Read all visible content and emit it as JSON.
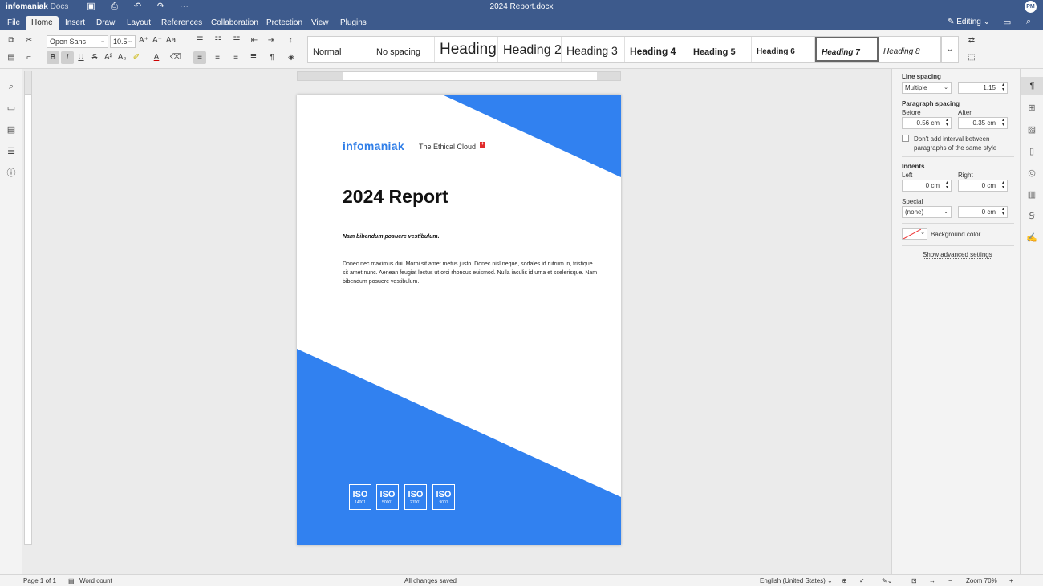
{
  "app": {
    "brand": "infomaniak",
    "brand_product": "Docs",
    "doc_title": "2024 Report.docx",
    "user_initials": "PM",
    "editing_label": "Editing"
  },
  "menu": {
    "file": "File",
    "home": "Home",
    "insert": "Insert",
    "draw": "Draw",
    "layout": "Layout",
    "references": "References",
    "collaboration": "Collaboration",
    "protection": "Protection",
    "view": "View",
    "plugins": "Plugins"
  },
  "toolbar": {
    "font_name": "Open Sans",
    "font_size": "10.5"
  },
  "styles": {
    "normal": "Normal",
    "no_spacing": "No spacing",
    "h1": "Heading",
    "h2": "Heading 2",
    "h3": "Heading 3",
    "h4": "Heading 4",
    "h5": "Heading 5",
    "h6": "Heading 6",
    "h7": "Heading 7",
    "h8": "Heading 8"
  },
  "document": {
    "logo": "infomaniak",
    "tagline": "The Ethical Cloud",
    "heading": "2024 Report",
    "subtitle": "Nam bibendum posuere vestibulum.",
    "body": "Donec nec maximus dui. Morbi sit amet metus justo. Donec nisl neque, sodales id rutrum in, tristique sit amet nunc. Aenean feugiat lectus ut orci rhoncus euismod. Nulla iaculis id urna et scelerisque. Nam bibendum posuere vestibulum.",
    "iso": [
      {
        "t": "ISO",
        "n": "14001"
      },
      {
        "t": "ISO",
        "n": "50001"
      },
      {
        "t": "ISO",
        "n": "27001"
      },
      {
        "t": "ISO",
        "n": "9001"
      }
    ]
  },
  "panel": {
    "line_spacing": "Line spacing",
    "line_mode": "Multiple",
    "line_value": "1.15",
    "para_spacing": "Paragraph spacing",
    "before": "Before",
    "after": "After",
    "before_val": "0.56 cm",
    "after_val": "0.35 cm",
    "dont_add": "Don't add interval between paragraphs of the same style",
    "indents": "Indents",
    "left": "Left",
    "right": "Right",
    "left_val": "0 cm",
    "right_val": "0 cm",
    "special": "Special",
    "special_mode": "(none)",
    "special_val": "0 cm",
    "bg_color": "Background color",
    "advanced": "Show advanced settings"
  },
  "status": {
    "page": "Page 1 of 1",
    "word_count": "Word count",
    "saved": "All changes saved",
    "language": "English (United States)",
    "zoom": "Zoom 70%"
  },
  "colors": {
    "accent": "#3d5a8c",
    "brand_blue": "#2f7ee8"
  }
}
